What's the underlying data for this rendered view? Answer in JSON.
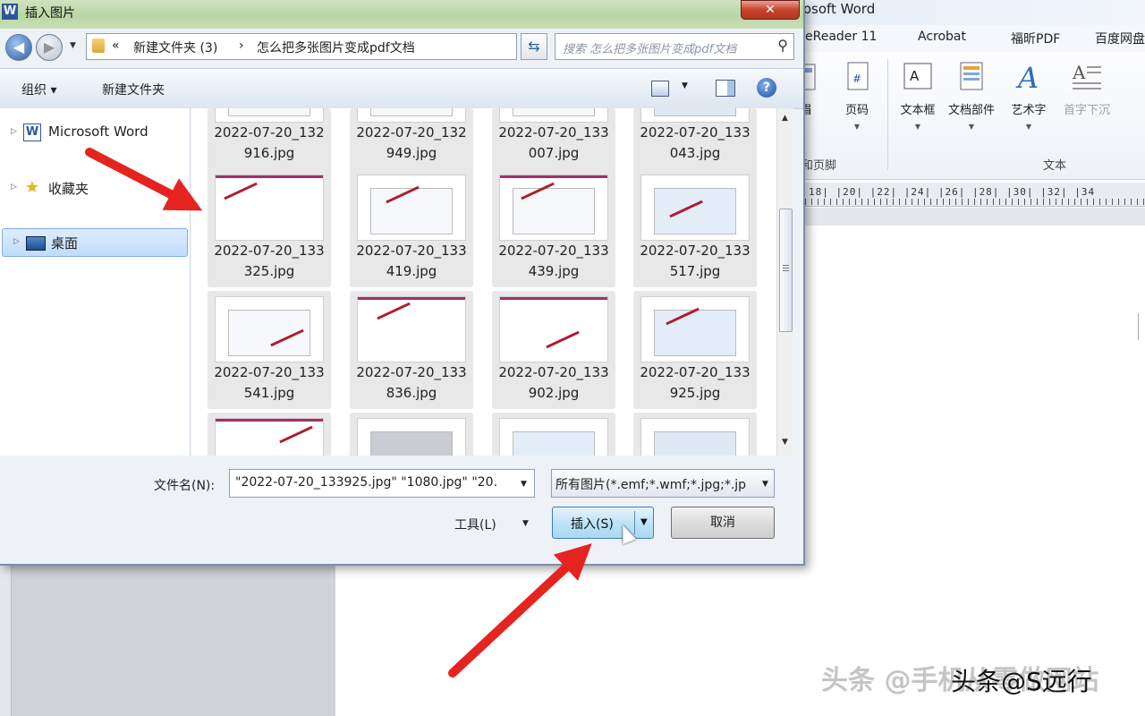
{
  "word": {
    "title": "rosoft Word",
    "tabs": [
      "eReader 11",
      "Acrobat",
      "福昕PDF",
      "百度网盘"
    ],
    "ribbon": {
      "buttons": [
        {
          "label": "眉",
          "icon": "header-icon"
        },
        {
          "label": "页码",
          "icon": "page-number-icon"
        },
        {
          "label": "文本框",
          "icon": "textbox-icon"
        },
        {
          "label": "文档部件",
          "icon": "quick-parts-icon"
        },
        {
          "label": "艺术字",
          "icon": "wordart-icon"
        },
        {
          "label": "首字下沉",
          "icon": "drop-cap-icon"
        }
      ],
      "groups": [
        "和页脚",
        "文本"
      ]
    },
    "ruler_numbers": "18| |20| |22| |24| |26| |28| |30| |32| |34"
  },
  "dialog": {
    "title": "插入图片",
    "close_symbol": "✕",
    "breadcrumb": [
      "«",
      "新建文件夹 (3)",
      "›",
      "怎么把多张图片变成pdf文档"
    ],
    "search_placeholder": "搜索 怎么把多张图片变成pdf文档",
    "toolbar": {
      "organize": "组织 ▾",
      "new_folder": "新建文件夹"
    },
    "nav_items": [
      {
        "label": "Microsoft Word",
        "icon": "word-icon",
        "selected": false
      },
      {
        "label": "收藏夹",
        "icon": "star-icon",
        "selected": false
      },
      {
        "label": "桌面",
        "icon": "desktop-icon",
        "selected": true
      }
    ],
    "files": [
      {
        "line1": "2022-07-20_132",
        "line2": "916.jpg"
      },
      {
        "line1": "2022-07-20_132",
        "line2": "949.jpg"
      },
      {
        "line1": "2022-07-20_133",
        "line2": "007.jpg"
      },
      {
        "line1": "2022-07-20_133",
        "line2": "043.jpg"
      },
      {
        "line1": "2022-07-20_133",
        "line2": "325.jpg"
      },
      {
        "line1": "2022-07-20_133",
        "line2": "419.jpg"
      },
      {
        "line1": "2022-07-20_133",
        "line2": "439.jpg"
      },
      {
        "line1": "2022-07-20_133",
        "line2": "517.jpg"
      },
      {
        "line1": "2022-07-20_133",
        "line2": "541.jpg"
      },
      {
        "line1": "2022-07-20_133",
        "line2": "836.jpg"
      },
      {
        "line1": "2022-07-20_133",
        "line2": "902.jpg"
      },
      {
        "line1": "2022-07-20_133",
        "line2": "925.jpg"
      }
    ],
    "filename_label": "文件名(N):",
    "filename_value": "\"2022-07-20_133925.jpg\" \"1080.jpg\" \"20.",
    "filetype_value": "所有图片(*.emf;*.wmf;*.jpg;*.jp",
    "tools_label": "工具(L)",
    "insert_label": "插入(S)",
    "cancel_label": "取消"
  },
  "watermark": "头条 @手机从零做网站",
  "credit": "头条@S远行",
  "colors": {
    "annotation_arrow": "#e52420",
    "title_bar": "#bcd7a9",
    "selected": "#c9dffc"
  }
}
